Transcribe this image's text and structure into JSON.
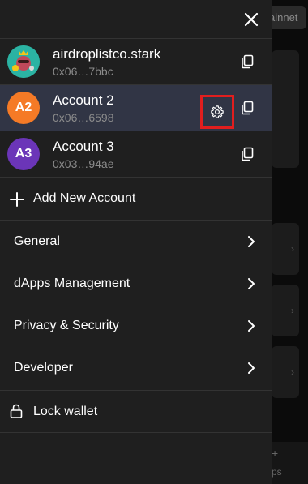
{
  "background": {
    "network_label": "ainnet",
    "bottom_label": "ps"
  },
  "drawer": {
    "close_icon": "close-icon",
    "accounts": [
      {
        "name": "airdroplistco.stark",
        "address": "0x06…7bbc",
        "avatar_initials": "",
        "avatar_color": "#2bb3a3",
        "selected": false
      },
      {
        "name": "Account 2",
        "address": "0x06…6598",
        "avatar_initials": "A2",
        "avatar_color": "#f57a26",
        "selected": true
      },
      {
        "name": "Account 3",
        "address": "0x03…94ae",
        "avatar_initials": "A3",
        "avatar_color": "#6b35b8",
        "selected": false
      }
    ],
    "add_account_label": "Add New Account",
    "menu": [
      {
        "label": "General"
      },
      {
        "label": "dApps Management"
      },
      {
        "label": "Privacy & Security"
      },
      {
        "label": "Developer"
      }
    ],
    "lock_label": "Lock wallet"
  },
  "colors": {
    "drawer_bg": "#1f1f1f",
    "selected_row_bg": "#313545",
    "highlight_border": "#e21e1e",
    "secondary_text": "#8c8c8c"
  }
}
